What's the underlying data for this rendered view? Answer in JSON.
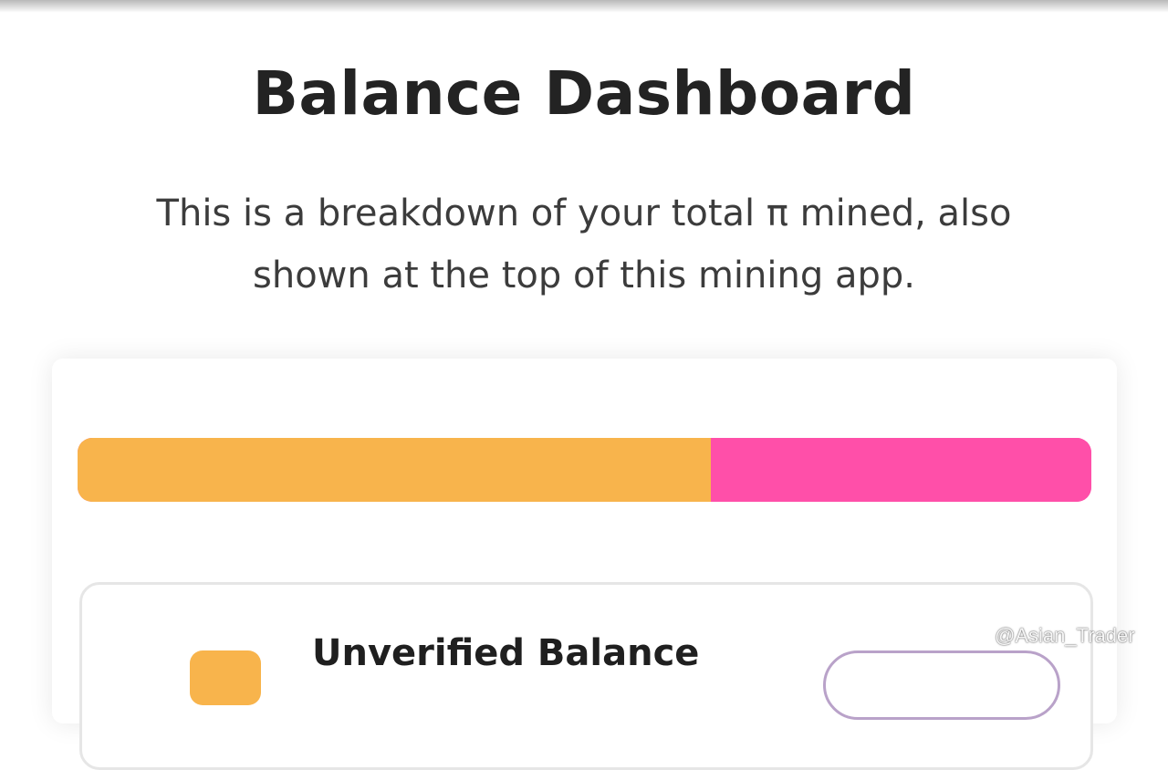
{
  "header": {
    "title": "Balance Dashboard",
    "description": "This is a breakdown of your total π mined, also shown at the top of this mining app."
  },
  "balance_bar": {
    "unverified_fraction": 0.625,
    "colors": {
      "unverified": "#f8b44c",
      "other": "#ff4fa9"
    }
  },
  "balance_items": [
    {
      "label": "Unverified Balance",
      "icon": "balance-color-swatch-icon",
      "color": "#f8b44c"
    }
  ],
  "watermark": {
    "text": "@Asian_Trader",
    "icon": "diamond-logo-icon"
  },
  "colors": {
    "background": "#ffffff",
    "title": "#232323",
    "text": "#3c3c3c",
    "card_border": "#e6e6e6",
    "pill_border": "#b9a2c9"
  }
}
